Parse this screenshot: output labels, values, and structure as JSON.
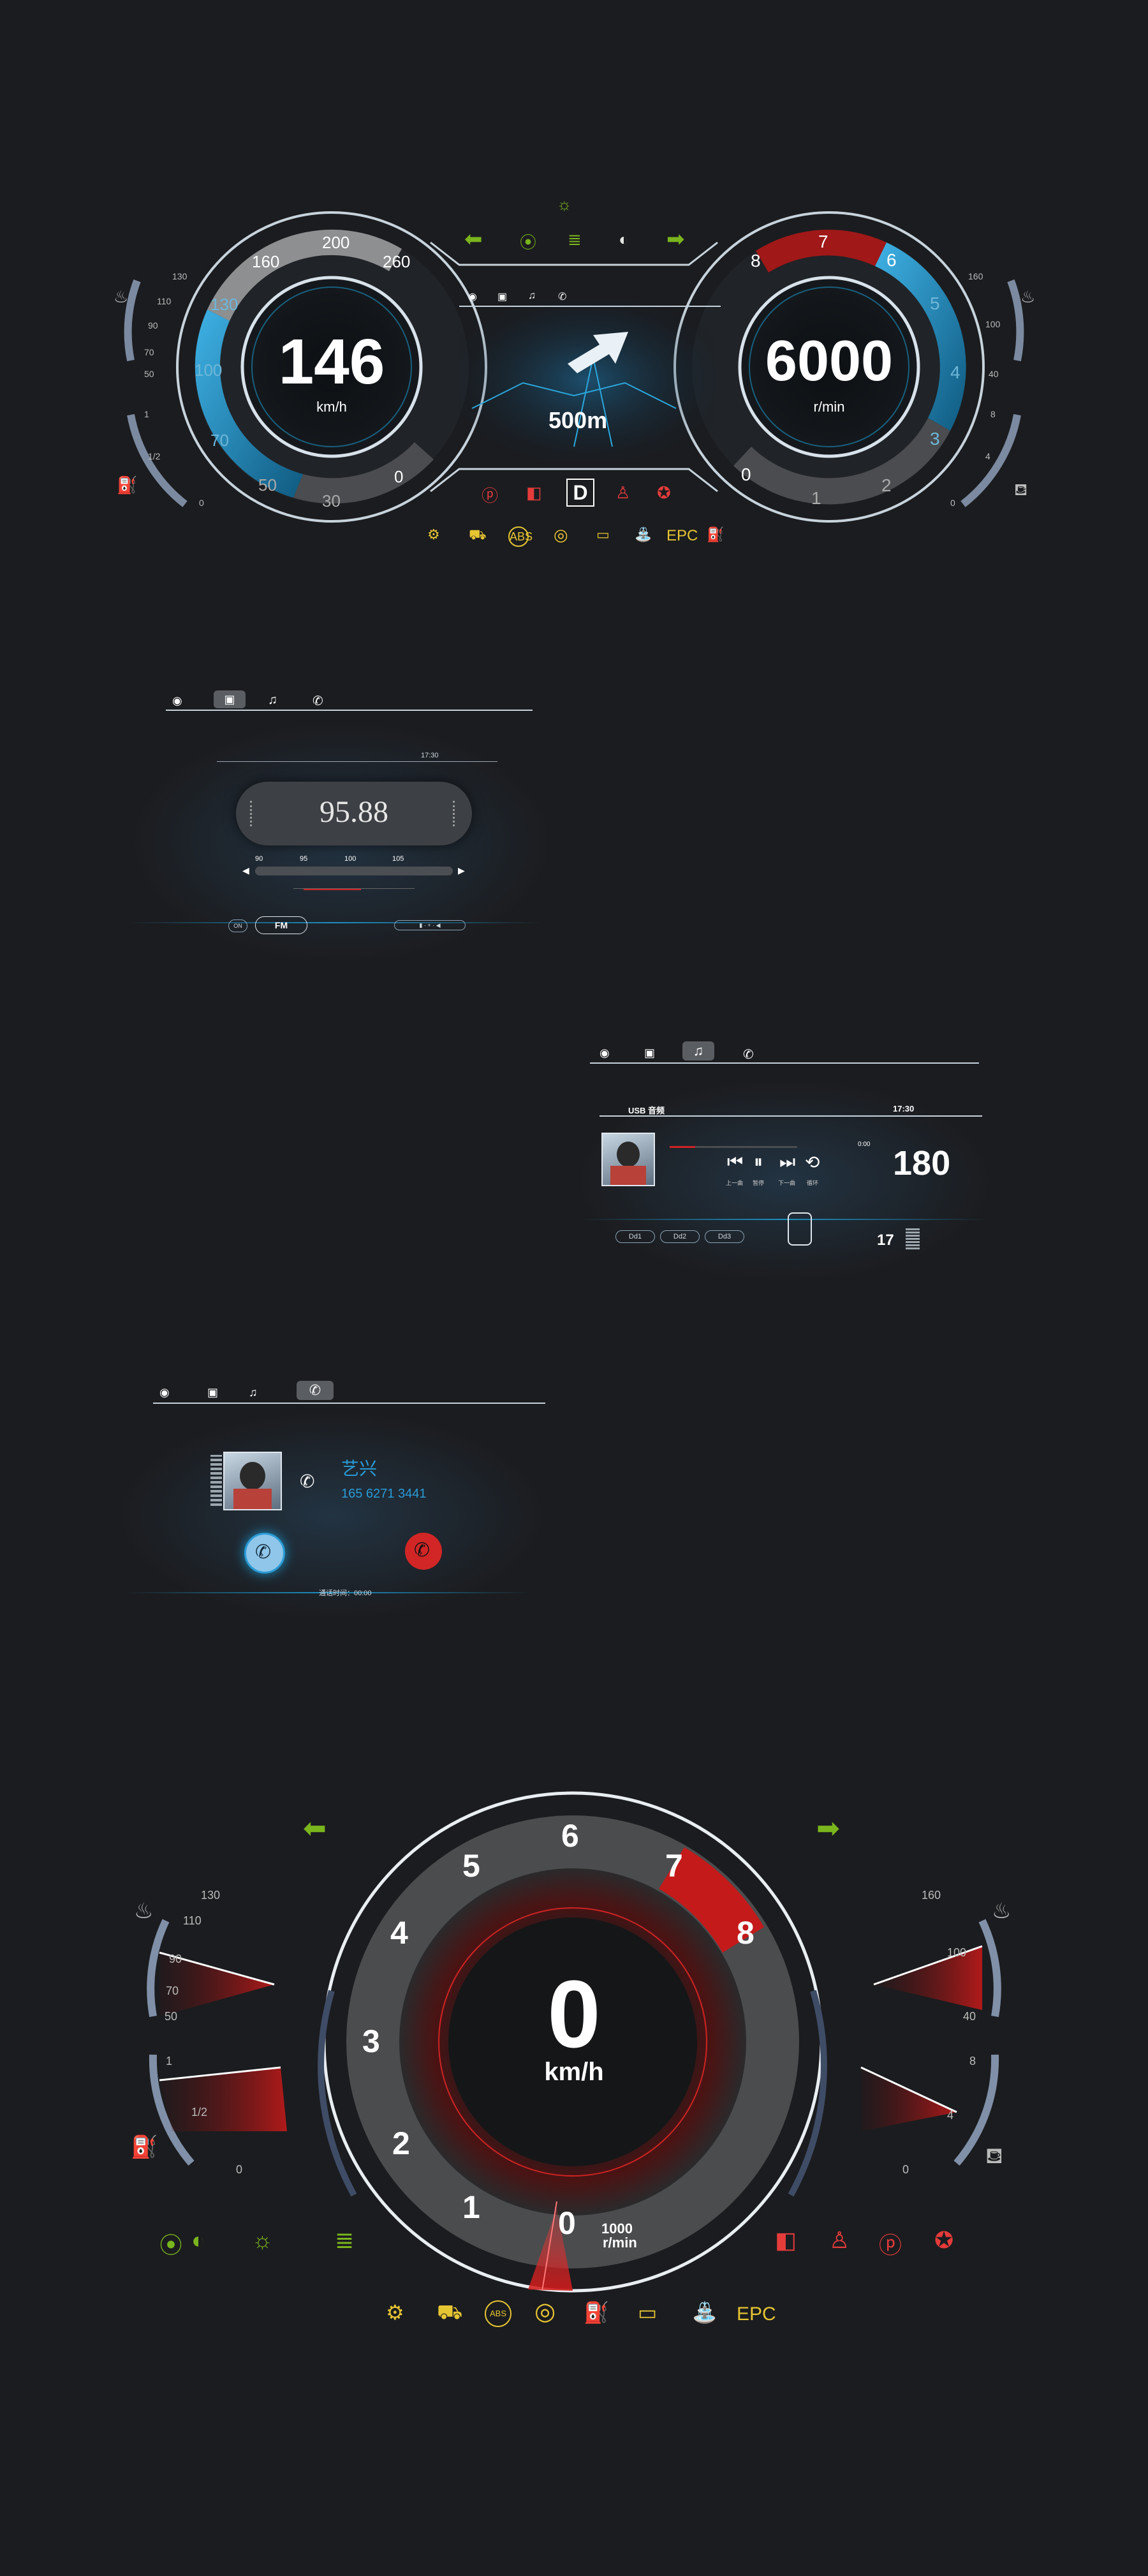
{
  "cluster1": {
    "speed": "146",
    "speed_unit": "km/h",
    "rpm": "6000",
    "rpm_unit": "r/min",
    "speed_ticks": [
      "0",
      "30",
      "50",
      "70",
      "100",
      "130",
      "160",
      "200",
      "260"
    ],
    "rpm_ticks": [
      "0",
      "1",
      "2",
      "3",
      "4",
      "5",
      "6",
      "7",
      "8"
    ],
    "temp_ticks": [
      "130",
      "110",
      "90",
      "70",
      "50"
    ],
    "fuel_ticks": [
      "1",
      "1/2",
      "0"
    ],
    "oil_temp_ticks": [
      "160",
      "100",
      "40"
    ],
    "oil_press_ticks": [
      "8",
      "4",
      "0"
    ],
    "nav_distance": "500m",
    "gear": "D",
    "warning_text": "EPC"
  },
  "radio": {
    "time": "17:30",
    "frequency": "95.88",
    "scale": [
      "90",
      "95",
      "100",
      "105"
    ],
    "band": "FM",
    "small_btn": "ON"
  },
  "usb": {
    "source": "USB 音频",
    "time": "17:30",
    "elapsed": "0:00",
    "speed": "180",
    "controls": [
      "上一曲",
      "暂停",
      "下一曲",
      "循环"
    ],
    "presets": [
      "Dd1",
      "Dd2",
      "Dd3"
    ],
    "volume": "17"
  },
  "phone": {
    "contact_name": "艺兴",
    "contact_number": "165 6271 3441",
    "call_time": "通话时间：00:00"
  },
  "cluster2": {
    "speed": "0",
    "speed_unit": "km/h",
    "rpm_ticks": [
      "0",
      "1",
      "2",
      "3",
      "4",
      "5",
      "6",
      "7",
      "8"
    ],
    "rpm_mult": "1000",
    "rpm_unit": "r/min",
    "temp_ticks": [
      "130",
      "110",
      "90",
      "70",
      "50"
    ],
    "fuel_ticks": [
      "1",
      "1/2",
      "0"
    ],
    "oil_temp_ticks": [
      "160",
      "100",
      "40"
    ],
    "oil_press_ticks": [
      "8",
      "4",
      "0"
    ],
    "warning_text": "EPC"
  },
  "colors": {
    "background": "#1b1c1f",
    "accent_blue": "#1c8fc0",
    "accent_red": "#c41a1a",
    "indicator_green": "#7ab51d",
    "warning_yellow": "#e6c532"
  }
}
